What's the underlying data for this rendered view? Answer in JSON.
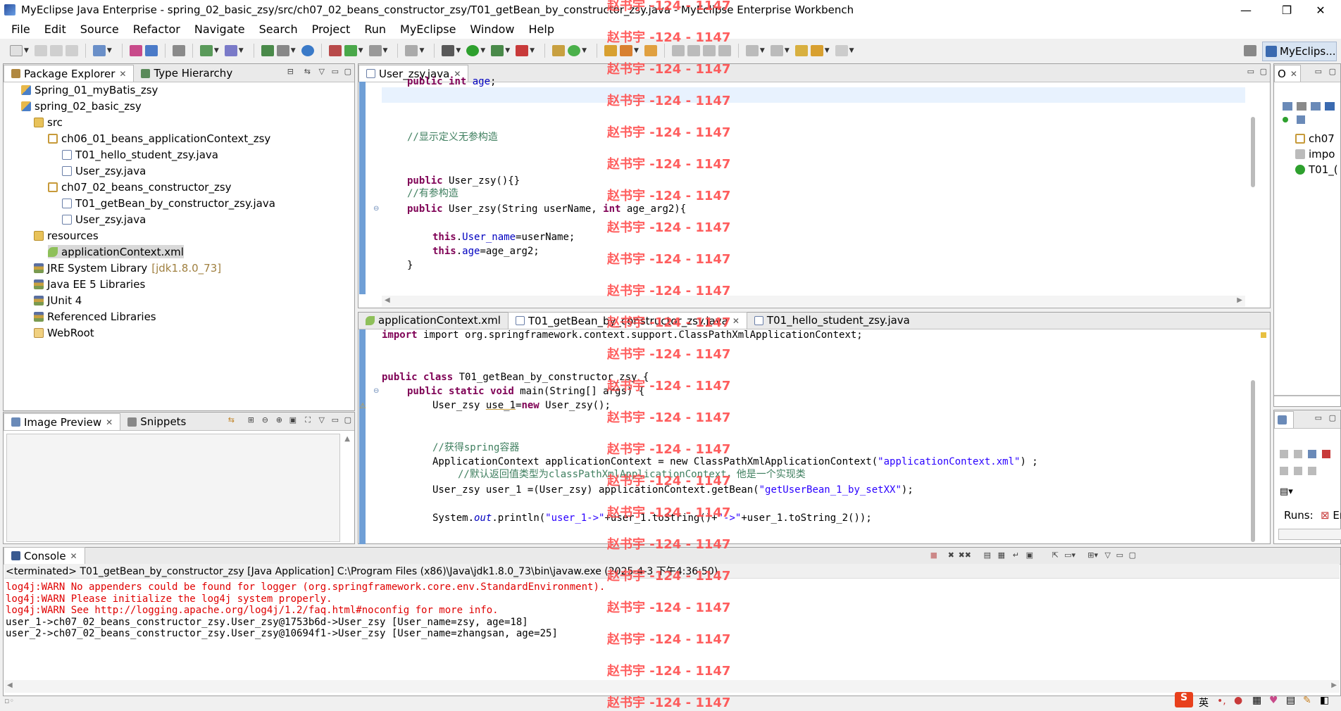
{
  "window": {
    "title": "MyEclipse Java Enterprise - spring_02_basic_zsy/src/ch07_02_beans_constructor_zsy/T01_getBean_by_constructor_zsy.java - MyEclipse Enterprise Workbench",
    "minimize": "—",
    "maximize": "❐",
    "close": "✕"
  },
  "menu": [
    "File",
    "Edit",
    "Source",
    "Refactor",
    "Navigate",
    "Search",
    "Project",
    "Run",
    "MyEclipse",
    "Window",
    "Help"
  ],
  "perspective": {
    "label": "MyEclips..."
  },
  "package_explorer": {
    "tabs": [
      "Package Explorer",
      "Type Hierarchy"
    ],
    "tree": [
      {
        "label": "Spring_01_myBatis_zsy",
        "icon": "project-icon"
      },
      {
        "label": "spring_02_basic_zsy",
        "icon": "project-icon"
      },
      {
        "label": "src",
        "icon": "folder-icon"
      },
      {
        "label": "ch06_01_beans_applicationContext_zsy",
        "icon": "package-icon"
      },
      {
        "label": "T01_hello_student_zsy.java",
        "icon": "java-file-icon"
      },
      {
        "label": "User_zsy.java",
        "icon": "java-file-icon"
      },
      {
        "label": "ch07_02_beans_constructor_zsy",
        "icon": "package-icon"
      },
      {
        "label": "T01_getBean_by_constructor_zsy.java",
        "icon": "java-file-icon"
      },
      {
        "label": "User_zsy.java",
        "icon": "java-file-icon"
      },
      {
        "label": "resources",
        "icon": "folder-icon"
      },
      {
        "label": "applicationContext.xml",
        "icon": "xml-file-icon"
      },
      {
        "label": "JRE System Library",
        "icon": "library-icon",
        "suffix": "[jdk1.8.0_73]"
      },
      {
        "label": "Java EE 5 Libraries",
        "icon": "library-icon"
      },
      {
        "label": "JUnit 4",
        "icon": "library-icon"
      },
      {
        "label": "Referenced Libraries",
        "icon": "library-icon"
      },
      {
        "label": "WebRoot",
        "icon": "web-folder-icon"
      }
    ]
  },
  "image_preview": {
    "tabs": [
      "Image Preview",
      "Snippets"
    ]
  },
  "editor_top": {
    "tab": "User_zsy.java",
    "lines": [
      "public int age;",
      "//显示定义无参构造",
      "public User_zsy(){}",
      "//有参构造",
      "public User_zsy(String userName, int age_arg2){",
      "this.User_name=userName;",
      "this.age=age_arg2;",
      "}"
    ]
  },
  "editor_bottom": {
    "tabs": [
      "applicationContext.xml",
      "T01_getBean_by_constructor_zsy.java",
      "T01_hello_student_zsy.java"
    ],
    "lines": {
      "import": "import org.springframework.context.support.ClassPathXmlApplicationContext;",
      "class_decl": "public class T01_getBean_by_constructor_zsy {",
      "main_decl": "public static void main(String[] args) {",
      "new_user": "User_zsy use_1=new User_zsy();",
      "comment1": "//获得spring容器",
      "ctx_pre": "ApplicationContext applicationContext = new ClassPathXmlApplicationContext(",
      "ctx_str": "\"applicationContext.xml\"",
      "ctx_post": ") ;",
      "comment2": "//默认返回值类型为classPathXmlApplicationContext，他是一个实现类",
      "getbean_pre": "User_zsy user_1 =(User_zsy) applicationContext.getBean(",
      "getbean_str": "\"getUserBean_1_by_setXX\"",
      "getbean_post": ");",
      "println_pre": "System.",
      "println_out": "out",
      "println_mid": ".println(",
      "println_s1": "\"user_1->\"",
      "println_mid2": "+user_1.toString()+",
      "println_s2": "\"->\"",
      "println_end": "+user_1.toString_2());"
    }
  },
  "outline": {
    "tab": "O",
    "items": [
      "ch07",
      "impo",
      "T01_("
    ]
  },
  "junit": {
    "runs_label": "Runs:",
    "errors_label": "Err"
  },
  "console": {
    "tab": "Console",
    "header": "<terminated> T01_getBean_by_constructor_zsy [Java Application] C:\\Program Files (x86)\\Java\\jdk1.8.0_73\\bin\\javaw.exe (2025-4-3 下午4:36:50)",
    "lines": [
      {
        "text": "log4j:WARN No appenders could be found for logger (org.springframework.core.env.StandardEnvironment).",
        "warn": true
      },
      {
        "text": "log4j:WARN Please initialize the log4j system properly.",
        "warn": true
      },
      {
        "text": "log4j:WARN See http://logging.apache.org/log4j/1.2/faq.html#noconfig for more info.",
        "warn": true
      },
      {
        "text": "user_1->ch07_02_beans_constructor_zsy.User_zsy@1753b6d->User_zsy [User_name=zsy, age=18]",
        "warn": false
      },
      {
        "text": "user_2->ch07_02_beans_constructor_zsy.User_zsy@10694f1->User_zsy [User_name=zhangsan, age=25]",
        "warn": false
      }
    ]
  },
  "watermark": "赵书宇 -124 - 1147",
  "taskbar": {
    "ime": "英"
  },
  "colors": {
    "keyword": "#7f0055",
    "comment": "#3f7f5f",
    "string": "#2a00ff",
    "field": "#0000c0",
    "warn": "#e00000",
    "watermark": "#ff4d4d"
  }
}
